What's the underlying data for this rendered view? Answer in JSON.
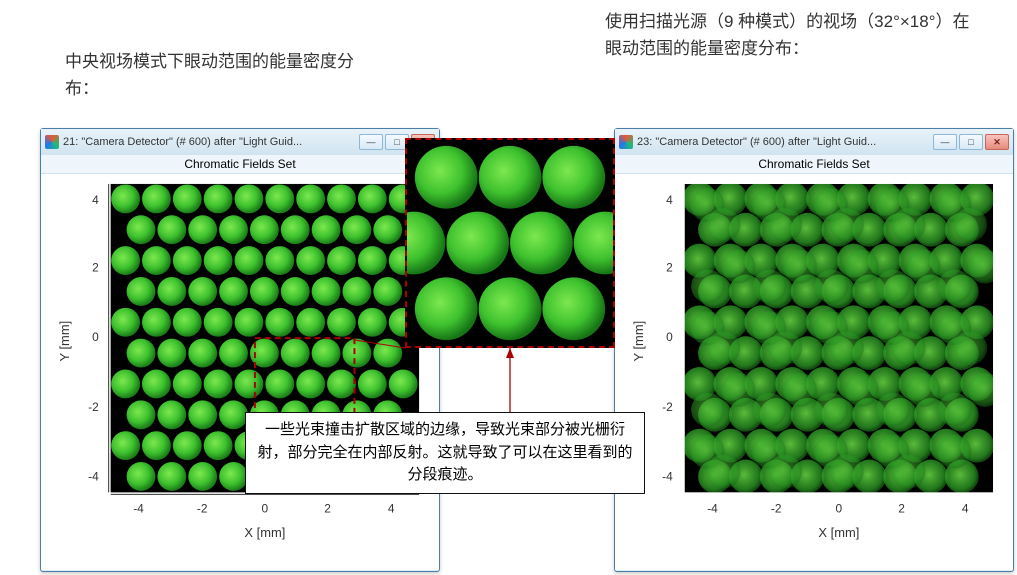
{
  "caption_left": "中央视场模式下眼动范围的能量密度分布：",
  "caption_right": "使用扫描光源（9 种模式）的视场（32°×18°）在眼动范围的能量密度分布：",
  "window_left": {
    "title": "21: \"Camera Detector\" (# 600) after \"Light Guid...",
    "subtitle": "Chromatic Fields Set",
    "btn_min": "—",
    "btn_max": "□",
    "btn_close": "✕"
  },
  "window_right": {
    "title": "23: \"Camera Detector\" (# 600) after \"Light Guid...",
    "subtitle": "Chromatic Fields Set",
    "btn_min": "—",
    "btn_max": "□",
    "btn_close": "✕"
  },
  "chart_data": [
    {
      "type": "heatmap",
      "title": "Chromatic Fields Set",
      "xlabel": "X [mm]",
      "ylabel": "Y [mm]",
      "xticks": [
        -4,
        -2,
        0,
        2,
        4
      ],
      "yticks": [
        -4,
        -2,
        0,
        2,
        4
      ],
      "xlim": [
        -5,
        5
      ],
      "ylim": [
        -5,
        5
      ],
      "pattern": "hexagonal-green-pupils",
      "description": "Discrete array of ~95 green circular pupils on black background, eyebox energy density for central FoV mode"
    },
    {
      "type": "heatmap",
      "title": "Chromatic Fields Set",
      "xlabel": "X [mm]",
      "ylabel": "Y [mm]",
      "xticks": [
        -4,
        -2,
        0,
        2,
        4
      ],
      "yticks": [
        -4,
        -2,
        0,
        2,
        4
      ],
      "xlim": [
        -5,
        5
      ],
      "ylim": [
        -5,
        5
      ],
      "pattern": "overlapping-blurred-green-pupils",
      "description": "Overlapping blurred green pupil replications (9 modes), eyebox energy density for scanned 32°×18° FoV"
    }
  ],
  "axes": {
    "xlabel": "X [mm]",
    "ylabel": "Y [mm]",
    "ticks": [
      "-4",
      "-2",
      "0",
      "2",
      "4"
    ]
  },
  "annotation": "一些光束撞击扩散区域的边缘，导致光束部分被光栅衍射，部分完全在内部反射。这就导致了可以在这里看到的分段痕迹。"
}
